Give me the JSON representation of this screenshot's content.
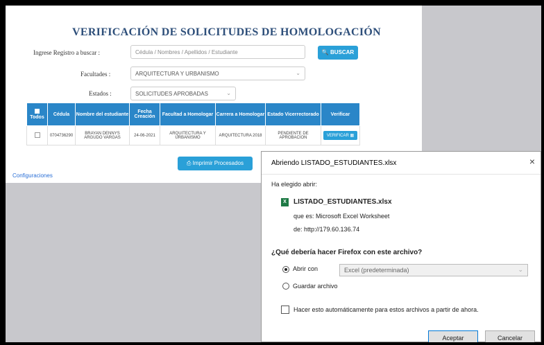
{
  "page": {
    "title": "VERIFICACIÓN DE SOLICITUDES DE HOMOLOGACIÓN",
    "search_label": "Ingrese Registro a buscar :",
    "search_placeholder": "Cédula / Nombres / Apellidos / Estudiante",
    "search_button": "BUSCAR",
    "faculty_label": "Facultades :",
    "faculty_value": "ARQUITECTURA Y URBANISMO",
    "state_label": "Estados :",
    "state_value": "SOLICITUDES APROBADAS",
    "print_button": "Imprimir Procesados",
    "config_link": "Configuraciones"
  },
  "table": {
    "headers": [
      "Todos",
      "Cédula",
      "Nombre del estudiante",
      "Fecha Creación",
      "Facultad a Homologar",
      "Carrera a Homologar",
      "Estado Vicerrectorado",
      "Verificar"
    ],
    "rows": [
      {
        "cedula": "0704736290",
        "nombre": "BRAYAN DENNYS ARGUDO VARGAS",
        "fecha": "24-06-2021",
        "facultad": "ARQUITECTURA Y URBANISMO",
        "carrera": "ARQUITECTURA 2018",
        "estado": "PENDIENTE DE APROBACION",
        "verificar": "VERIFICAR"
      }
    ]
  },
  "dialog": {
    "title": "Abriendo LISTADO_ESTUDIANTES.xlsx",
    "close": "×",
    "chosen_label": "Ha elegido abrir:",
    "filename": "LISTADO_ESTUDIANTES.xlsx",
    "type_line": "que es: Microsoft Excel Worksheet",
    "from_line": "de: http://179.60.136.74",
    "question": "¿Qué debería hacer Firefox con este archivo?",
    "open_with_label": "Abrir con",
    "open_with_app": "Excel (predeterminada)",
    "save_label": "Guardar archivo",
    "auto_label": "Hacer esto automáticamente para estos archivos a partir de ahora.",
    "accept_button": "Aceptar",
    "cancel_button": "Cancelar",
    "file_icon": "xlsx-file-icon"
  },
  "colors": {
    "accent": "#2aa0d8",
    "header": "#2a86c8",
    "title": "#2e4f7a"
  }
}
